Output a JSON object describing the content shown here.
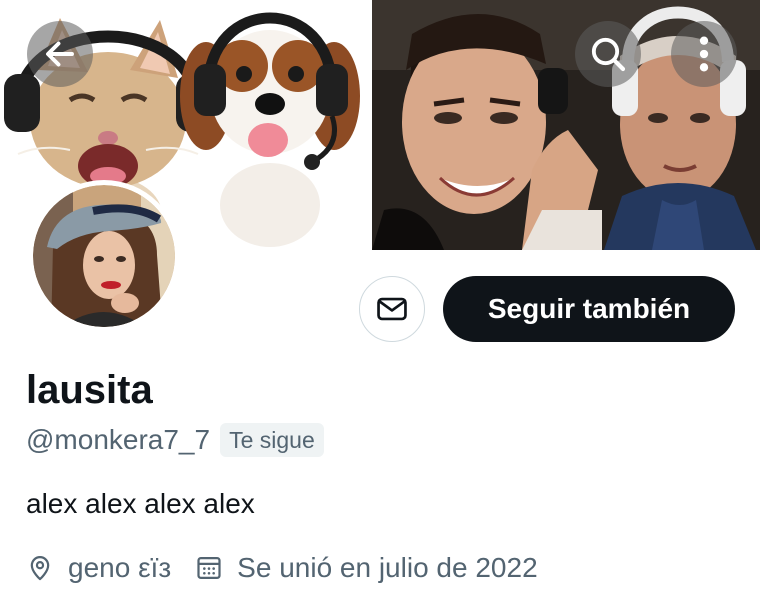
{
  "header": {
    "back_icon": "arrow-left-icon",
    "search_icon": "search-icon",
    "more_icon": "more-vertical-icon",
    "banner_left": "cat and dog wearing headphones",
    "banner_right": "two men wearing headphones"
  },
  "profile": {
    "display_name": "lausita",
    "handle": "@monkera7_7",
    "follows_you": "Te sigue",
    "bio": "alex alex alex alex",
    "location": "geno εïз",
    "joined": "Se unió en julio de 2022",
    "location_icon": "location-pin-icon",
    "joined_icon": "calendar-icon"
  },
  "actions": {
    "message_icon": "mail-icon",
    "follow_back_label": "Seguir también"
  },
  "colors": {
    "primary_text": "#0f1419",
    "secondary_text": "#536471",
    "follow_button_bg": "#0f1419",
    "follow_button_text": "#ffffff",
    "badge_bg": "#eff3f4",
    "border": "#cfd9de"
  }
}
